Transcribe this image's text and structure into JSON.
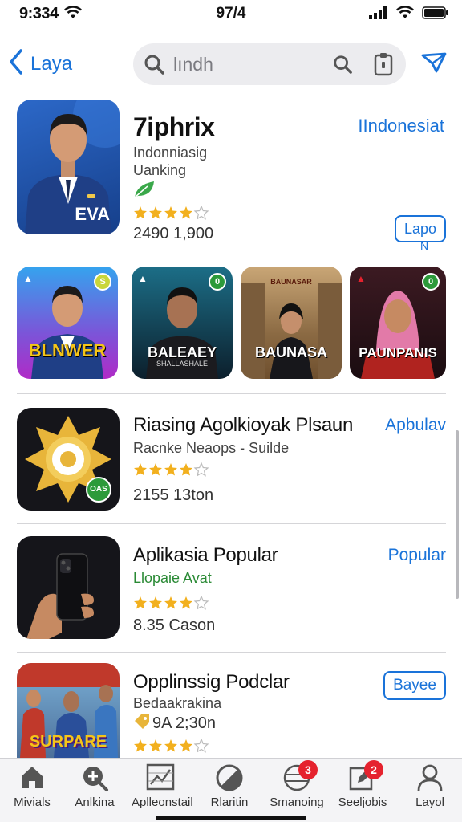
{
  "status": {
    "time": "9:334",
    "center": "97/4"
  },
  "nav": {
    "back_label": "Laya",
    "search_text": "lındh"
  },
  "featured": {
    "title": "7iphrix",
    "action_label": "IIndonesiat",
    "subtitle1": "Indonniasig",
    "subtitle2": "Uanking",
    "rating": 4.5,
    "stats": "2490  1,900",
    "button_label": "Lapo",
    "button_sub": "N",
    "image_caption": "EVA"
  },
  "grid": [
    {
      "label": "BLNWER",
      "badge": "S",
      "colors": [
        "#35a3ee",
        "#b02bc7"
      ]
    },
    {
      "label": "BALEAEY",
      "sub": "SHALLASHALE",
      "badge": "0",
      "colors": [
        "#1c6e87",
        "#0c1f2c"
      ]
    },
    {
      "label": "BAUNASA",
      "sub": "BAUNASAR",
      "badge": "",
      "colors": [
        "#c9a676",
        "#6e4f2e"
      ]
    },
    {
      "label": "PAUNPANIS",
      "sub": "",
      "badge": "0",
      "colors": [
        "#3c1a22",
        "#1a0c10"
      ]
    }
  ],
  "rows": [
    {
      "title": "Riasing Agolkioyak Plsaun",
      "action": "Apbulav",
      "subtitle": "Racnke Neaops  -  Suilde",
      "rating": 4.5,
      "stats": "2155  13ton",
      "badge_text": "OAS"
    },
    {
      "title": "Aplikasia Popular",
      "action": "Popular",
      "subtitle": "Llopaie Avat",
      "rating": 4.5,
      "stats": "8.35   Cason"
    },
    {
      "title": "Opplinssig Podclar",
      "button": "Bayee",
      "subtitle": "Bedaakrakina",
      "stats": "9A  2;30n",
      "rating": 4.5,
      "image_caption": "SURPARE"
    }
  ],
  "tabs": [
    {
      "label": "Mivials",
      "icon": "home-icon"
    },
    {
      "label": "Anlkina",
      "icon": "zoom-plus-icon"
    },
    {
      "label": "Aplleonstail",
      "icon": "chart-icon"
    },
    {
      "label": "Rlaritin",
      "icon": "slash-circle-icon"
    },
    {
      "label": "Smanoing",
      "icon": "globe-icon",
      "badge": "3"
    },
    {
      "label": "Seeljobis",
      "icon": "edit-icon",
      "badge": "2"
    },
    {
      "label": "Layol",
      "icon": "person-icon"
    }
  ],
  "colors": {
    "accent": "#1a73d9",
    "star": "#f2b01e",
    "badge": "#e5222e"
  }
}
